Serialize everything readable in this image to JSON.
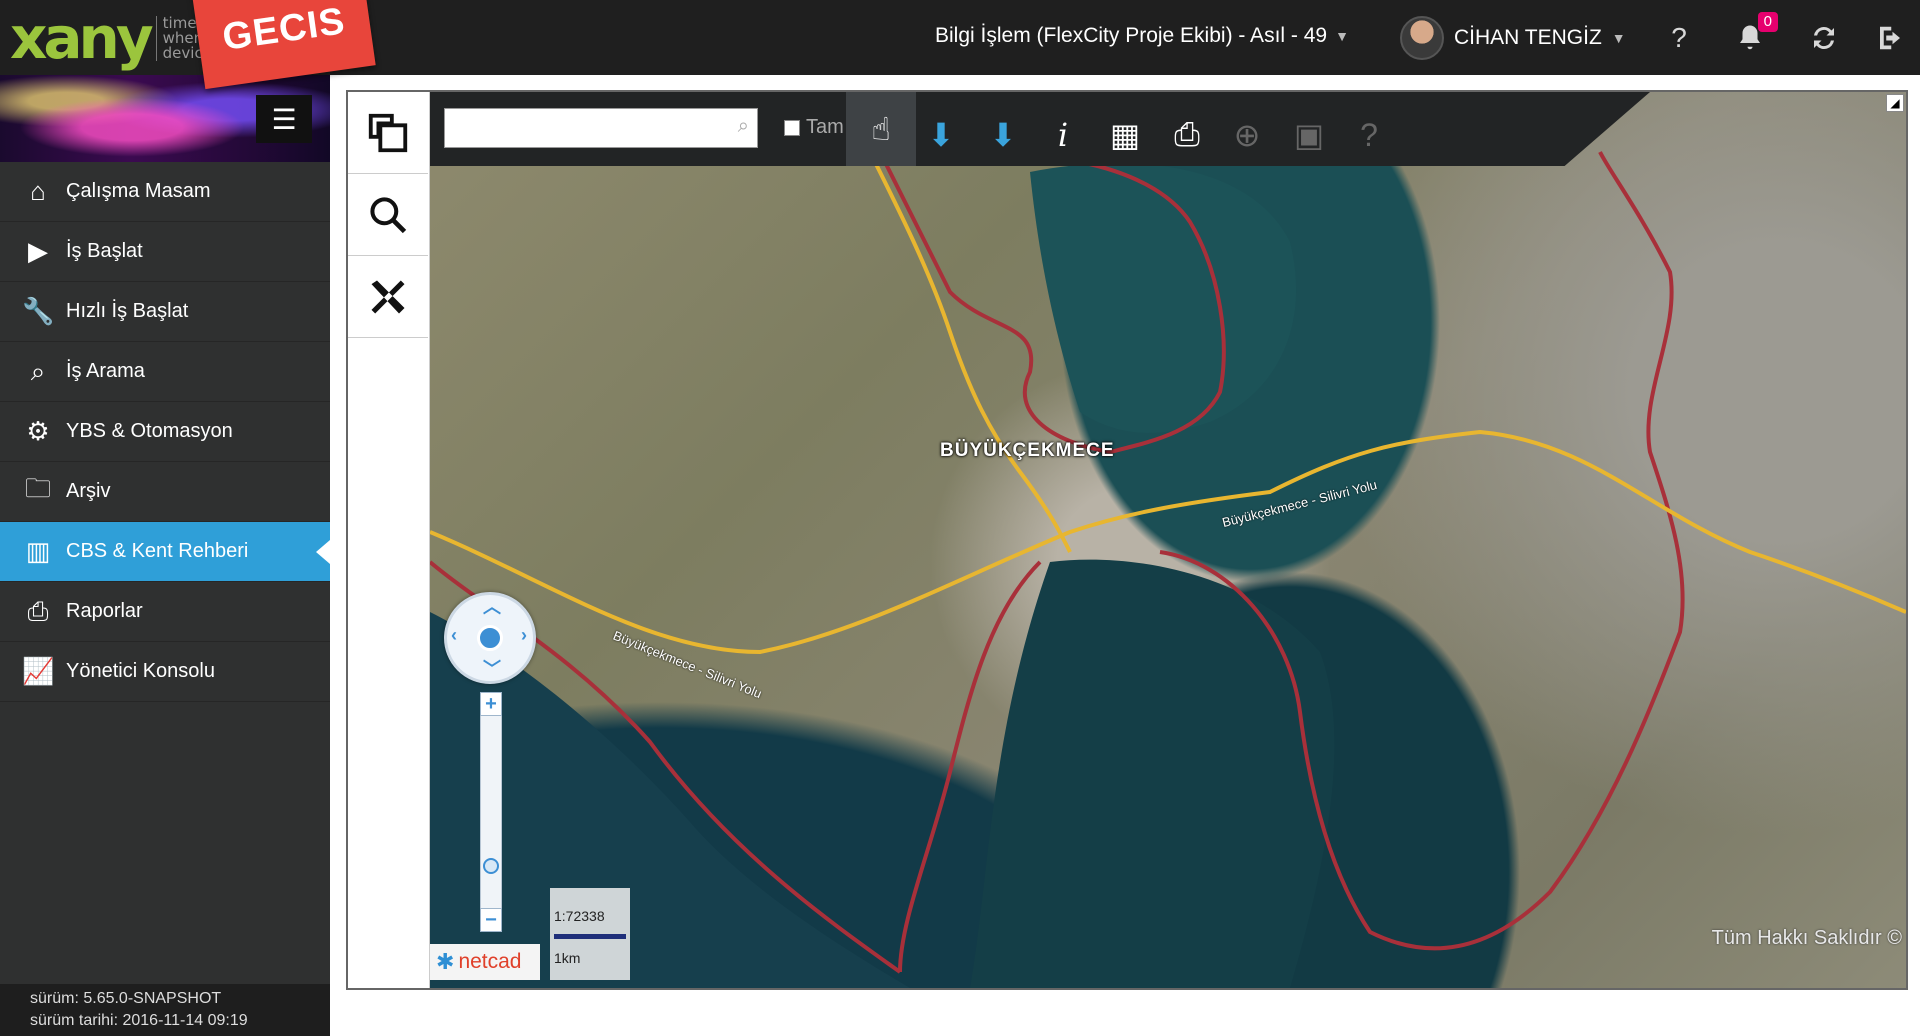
{
  "header": {
    "logo_text": "xany",
    "logo_tag": [
      "time",
      "where",
      "device"
    ],
    "ribbon": "GECIS",
    "context": "Bilgi İşlem (FlexCity Proje Ekibi) - Asıl - 49",
    "user_name": "CİHAN TENGİZ",
    "help": "?",
    "notification_count": "0"
  },
  "sidebar": {
    "items": [
      {
        "label": "Çalışma Masam",
        "icon": "home-icon"
      },
      {
        "label": "İş Başlat",
        "icon": "play-icon"
      },
      {
        "label": "Hızlı İş Başlat",
        "icon": "wrench-icon"
      },
      {
        "label": "İş Arama",
        "icon": "search-icon"
      },
      {
        "label": "YBS & Otomasyon",
        "icon": "gear-icon"
      },
      {
        "label": "Arşiv",
        "icon": "folder-icon"
      },
      {
        "label": "CBS & Kent Rehberi",
        "icon": "map-icon",
        "active": true
      },
      {
        "label": "Raporlar",
        "icon": "print-icon"
      },
      {
        "label": "Yönetici Konsolu",
        "icon": "chart-icon"
      }
    ],
    "version_line1": "sürüm: 5.65.0-SNAPSHOT",
    "version_line2": "sürüm tarihi: 2016-11-14 09:19"
  },
  "map": {
    "search_placeholder": "",
    "fullscreen_label": "Tam",
    "place_label": "BÜYÜKÇEKMECE",
    "road_label_1": "Büyükçekmece - Silivri Yolu",
    "road_label_2": "Büyükçekmece - Silivri Yolu",
    "scale_ratio": "1:72338",
    "scale_distance": "1km",
    "brand": "netcad",
    "copyright": "Tüm Hakkı Saklıdır ©",
    "colors": {
      "road": "#e8b630",
      "boundary": "#a8303a",
      "accent": "#2f9fd8"
    }
  }
}
